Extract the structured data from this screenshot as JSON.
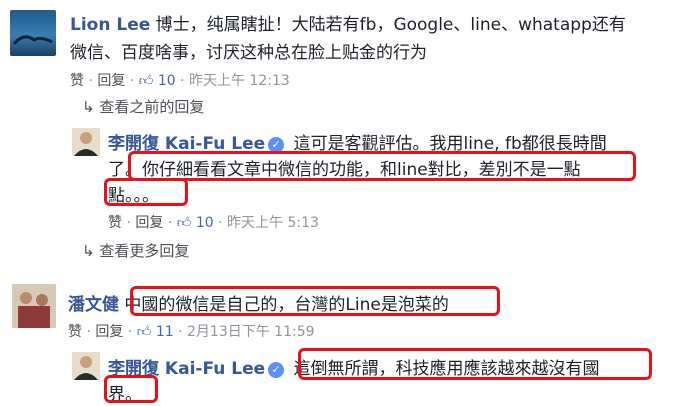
{
  "comments": [
    {
      "author": "Lion Lee",
      "line1": "博士，纯属瞎扯！大陆若有fb，Google、line、whatapp还有",
      "line2": "微信、百度啥事，讨厌这种总在脸上贴金的行为",
      "like": "赞",
      "reply": "回复",
      "likes": "10",
      "time": "昨天上午 12:13"
    },
    {
      "author": "潘文健",
      "text": "中國的微信是自己的，台灣的Line是泡菜的",
      "like": "赞",
      "reply": "回复",
      "likes": "11",
      "time": "2月13日下午 11:59"
    }
  ],
  "replies": [
    {
      "author": "李開復 Kai-Fu Lee",
      "line1": "這可是客觀評估。我用line, fb都很長時間",
      "line2_pre": "了。",
      "line2_hl": "你仔細看看文章中微信的功能，和line對比，差別不是一點",
      "line3": "點。。。",
      "like": "赞",
      "reply": "回复",
      "likes": "10",
      "time": "昨天上午 5:13"
    },
    {
      "author": "李開復 Kai-Fu Lee",
      "line1": "這倒無所謂，科技應用應該越來越沒有國",
      "line2": "界。"
    }
  ],
  "view_previous": "查看之前的回复",
  "view_more": "查看更多回复",
  "separator": "·",
  "colors": {
    "name": "#365899",
    "meta": "#90949c",
    "highlight": "#e8101a",
    "like": "#4267b2"
  },
  "icons": {
    "like": "thumbs-up-icon",
    "reply_arrow": "reply-arrow-icon",
    "verified": "verified-badge-icon"
  }
}
